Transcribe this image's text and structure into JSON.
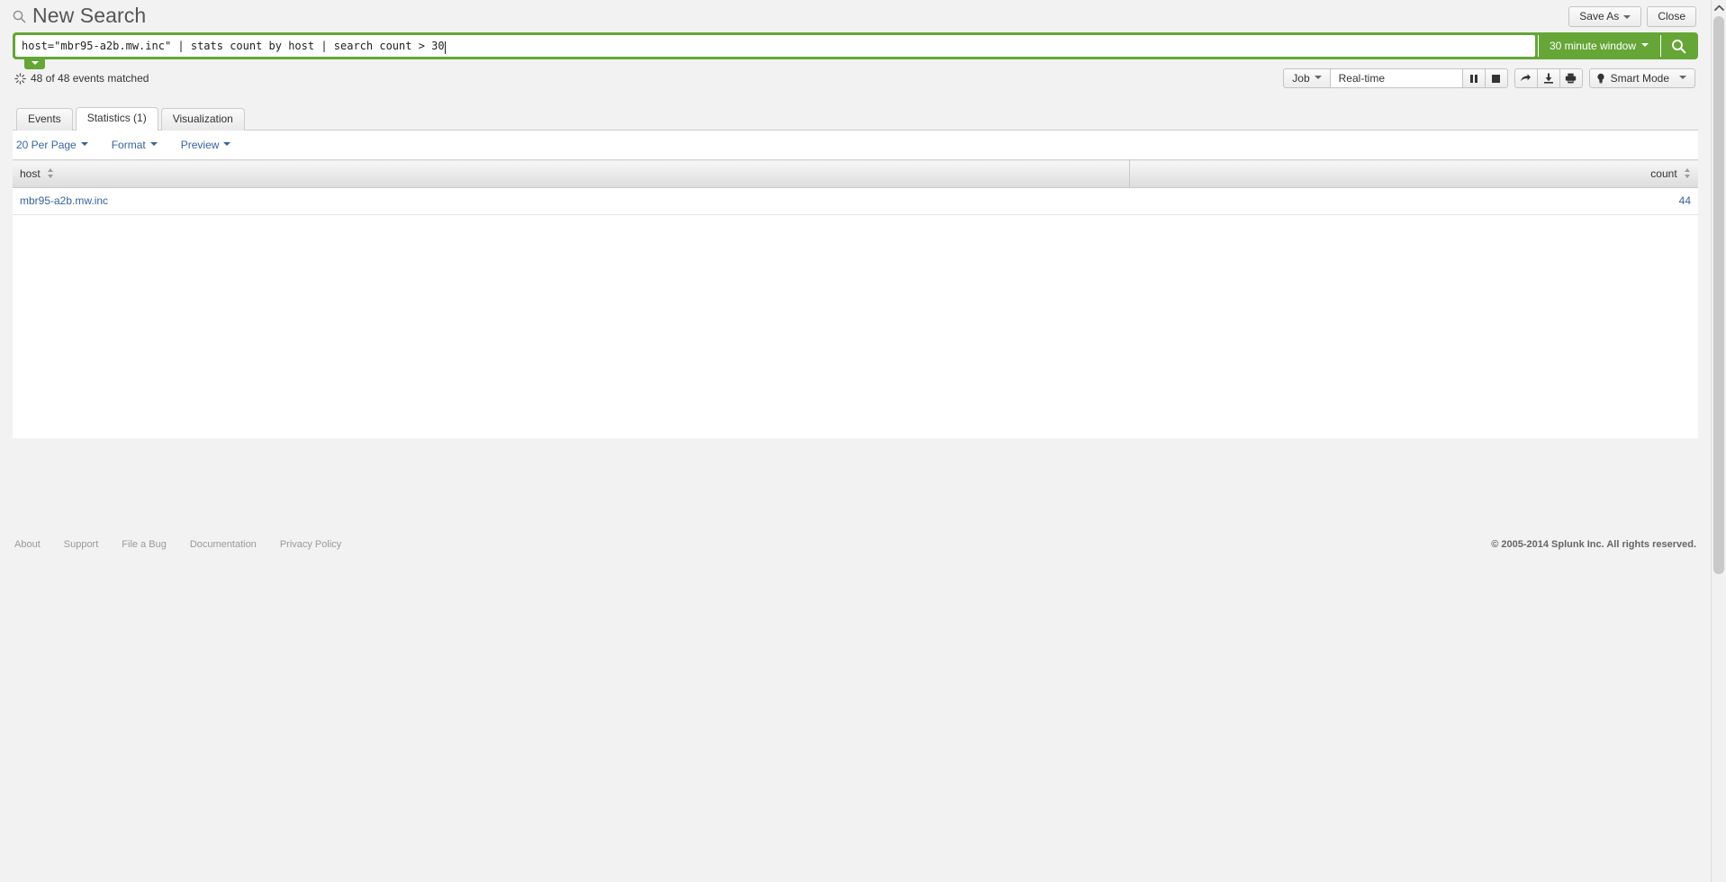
{
  "header": {
    "title": "New Search",
    "search_icon": "search-icon",
    "save_as_label": "Save As",
    "close_label": "Close"
  },
  "search": {
    "query": "host=\"mbr95-a2b.mw.inc\" | stats count by host | search count > 30",
    "time_range_label": "30 minute window",
    "submit_icon": "magnifier-icon",
    "expander_icon": "chevron-down-icon"
  },
  "job_status": {
    "spinner_icon": "loading-spinner-icon",
    "events_matched": "48 of 48 events matched",
    "job_label": "Job",
    "job_readout": "Real-time",
    "pause_icon": "pause-icon",
    "stop_icon": "stop-icon",
    "share_icon": "share-arrow-icon",
    "export_icon": "download-icon",
    "print_icon": "print-icon",
    "mode_icon": "lightbulb-icon",
    "mode_label": "Smart Mode"
  },
  "tabs": [
    {
      "label": "Events",
      "active": false
    },
    {
      "label": "Statistics (1)",
      "active": true
    },
    {
      "label": "Visualization",
      "active": false
    }
  ],
  "results_toolbar": {
    "per_page_label": "20 Per Page",
    "format_label": "Format",
    "preview_label": "Preview"
  },
  "results_table": {
    "columns": [
      "host",
      "count"
    ],
    "rows": [
      {
        "host": "mbr95-a2b.mw.inc",
        "count": "44"
      }
    ]
  },
  "footer": {
    "links": [
      "About",
      "Support",
      "File a Bug",
      "Documentation",
      "Privacy Policy"
    ],
    "copyright": "© 2005-2014 Splunk Inc. All rights reserved."
  },
  "colors": {
    "accent_green": "#65a637",
    "link_blue": "#3863a0",
    "page_bg": "#f2f2f2"
  }
}
